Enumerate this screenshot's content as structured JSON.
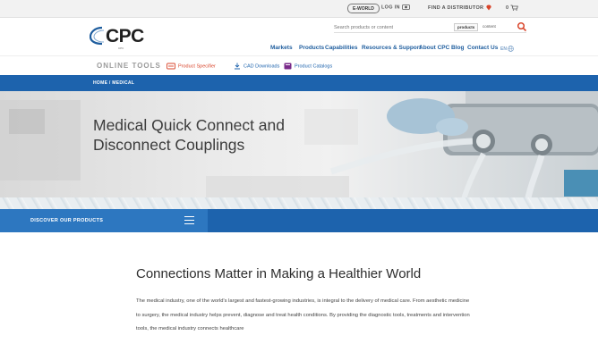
{
  "utility": {
    "eworld_label": "E-WORLD",
    "login_label": "LOG IN",
    "distributor_label": "FIND A DISTRIBUTOR",
    "cart_label": "0"
  },
  "header": {
    "logo_text": "CPC",
    "logo_tag": "CPC",
    "search_placeholder": "Search products or content",
    "search_option_products": "products",
    "search_option_content": "content",
    "nav": [
      {
        "label": "Markets"
      },
      {
        "label": "Products"
      },
      {
        "label": "Capabilities"
      },
      {
        "label": "Resources & Support"
      },
      {
        "label": "About CPC"
      },
      {
        "label": "Blog"
      },
      {
        "label": "Contact Us"
      },
      {
        "label": "EN"
      }
    ]
  },
  "tools": {
    "title": "ONLINE TOOLS",
    "items": [
      {
        "label": "Product Specifier",
        "color": "#d9452b"
      },
      {
        "label": "CAD Downloads",
        "color": "#1d63ad"
      },
      {
        "label": "Product Catalogs",
        "color": "#7a2a8a"
      }
    ]
  },
  "breadcrumb": "HOME / MEDICAL",
  "hero": {
    "title": "Medical Quick Connect and Disconnect Couplings"
  },
  "discover": {
    "label": "DISCOVER OUR PRODUCTS"
  },
  "content": {
    "title": "Connections Matter in Making a Healthier World",
    "body": "The medical industry, one of the world's largest and fastest-growing industries, is integral to the delivery of medical care. From aesthetic medicine to surgery, the medical industry helps prevent, diagnose and treat health conditions. By providing the diagnostic tools, treatments and intervention tools, the medical industry connects healthcare"
  },
  "colors": {
    "brand_blue": "#1d63ad",
    "accent_red": "#d9452b"
  }
}
